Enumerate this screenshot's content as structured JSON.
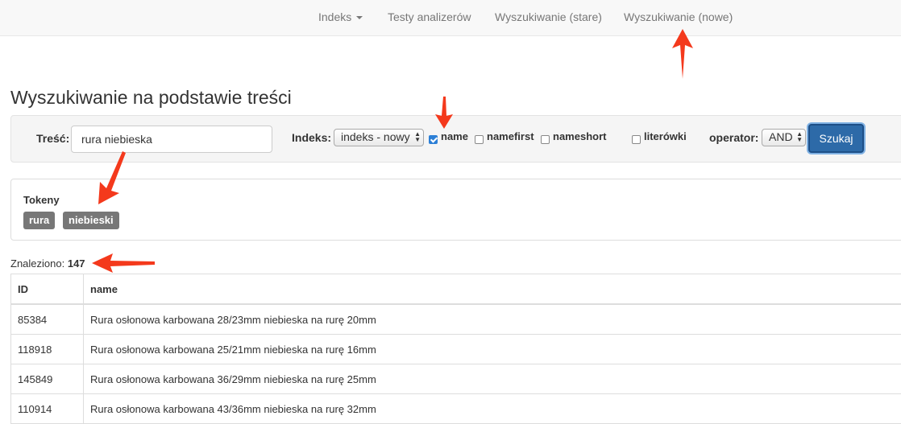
{
  "nav": {
    "items": [
      {
        "label": "Indeks",
        "dropdown": true
      },
      {
        "label": "Testy analizerów"
      },
      {
        "label": "Wyszukiwanie (stare)"
      },
      {
        "label": "Wyszukiwanie (nowe)"
      }
    ]
  },
  "page": {
    "title": "Wyszukiwanie na podstawie treści"
  },
  "form": {
    "content_label": "Treść:",
    "content_value": "rura niebieska",
    "index_label": "Indeks:",
    "index_value": "indeks - nowy",
    "fields": [
      {
        "label": "name",
        "checked": true
      },
      {
        "label": "namefirst",
        "checked": false
      },
      {
        "label": "nameshort",
        "checked": false
      },
      {
        "label": "literówki",
        "checked": false
      }
    ],
    "operator_label": "operator:",
    "operator_value": "AND",
    "search_button": "Szukaj"
  },
  "tokens": {
    "heading": "Tokeny",
    "items": [
      "rura",
      "niebieski"
    ]
  },
  "results": {
    "found_label": "Znaleziono:",
    "count": "147",
    "columns": [
      "ID",
      "name"
    ],
    "rows": [
      {
        "id": "85384",
        "name": "Rura osłonowa karbowana 28/23mm niebieska na rurę 20mm"
      },
      {
        "id": "118918",
        "name": "Rura osłonowa karbowana 25/21mm niebieska na rurę 16mm"
      },
      {
        "id": "145849",
        "name": "Rura osłonowa karbowana 36/29mm niebieska na rurę 25mm"
      },
      {
        "id": "110914",
        "name": "Rura osłonowa karbowana 43/36mm niebieska na rurę 32mm"
      }
    ]
  },
  "colors": {
    "annotation_arrow": "#f4391c",
    "button": "#2d6aa8",
    "badge": "#777777"
  }
}
